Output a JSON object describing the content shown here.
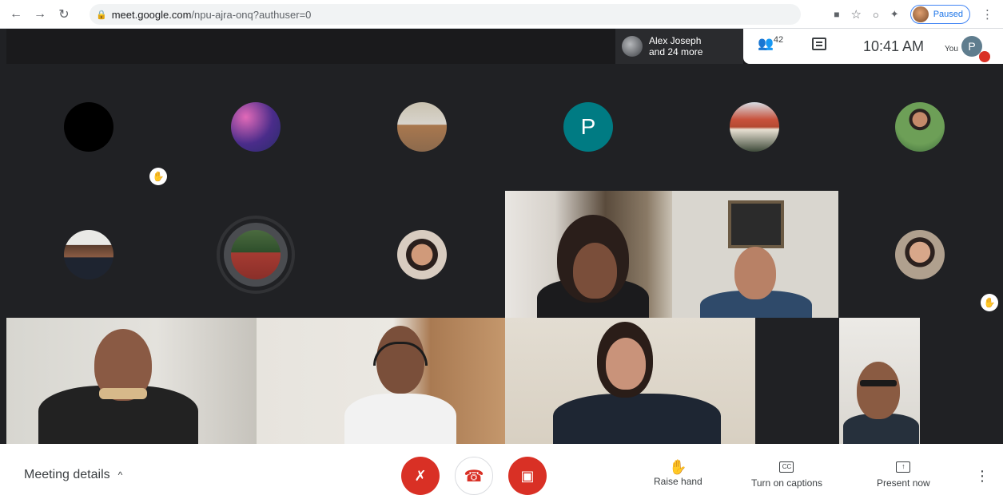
{
  "browser": {
    "url_host": "meet.google.com",
    "url_path": "/npu-ajra-onq?authuser=0",
    "profile_status": "Paused"
  },
  "header": {
    "active_speaker_name": "Alex Joseph",
    "active_speaker_more": "and 24 more",
    "participant_count": "42",
    "clock": "10:41 AM",
    "you_label": "You",
    "you_initial": "P"
  },
  "tiles": {
    "letter_avatar": "P"
  },
  "controls": {
    "meeting_details_label": "Meeting details",
    "raise_hand_label": "Raise hand",
    "captions_label": "Turn on captions",
    "present_label": "Present now"
  },
  "colors": {
    "stage_bg": "#202124",
    "danger": "#d93025",
    "teal_avatar": "#007b83",
    "accent_blue": "#1a73e8"
  },
  "icons": {
    "back": "arrow-left-icon",
    "forward": "arrow-right-icon",
    "reload": "reload-icon",
    "lock": "lock-icon",
    "people": "people-icon",
    "chat": "chat-icon",
    "mic_off": "mic-off-icon",
    "hangup": "phone-hangup-icon",
    "cam_off": "camera-off-icon",
    "raise_hand": "hand-icon",
    "captions": "captions-icon",
    "present": "present-screen-icon",
    "more": "more-vertical-icon"
  }
}
